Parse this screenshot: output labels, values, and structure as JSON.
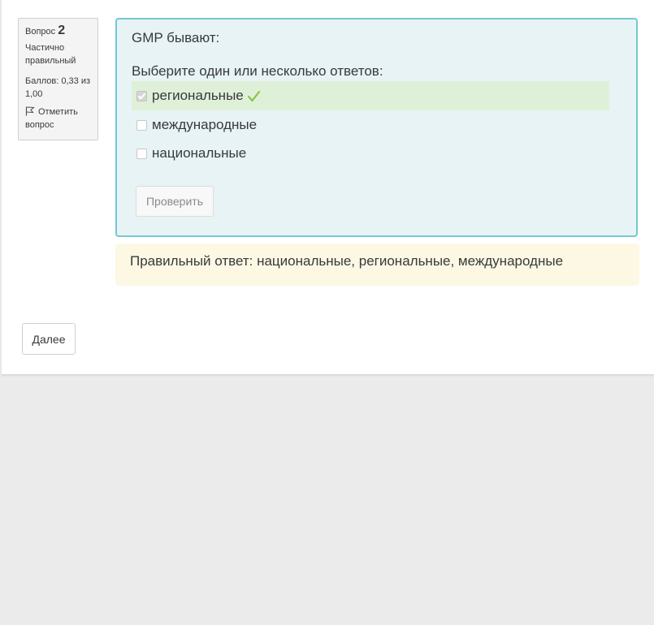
{
  "question_info": {
    "label": "Вопрос",
    "number": "2",
    "state": "Частично правильный",
    "grade": "Баллов: 0,33 из 1,00",
    "flag_label": "Отметить вопрос"
  },
  "question": {
    "text": "GMP бывают:",
    "prompt": "Выберите один или несколько ответов:",
    "options": [
      {
        "label": "региональные",
        "checked": true,
        "correct": true
      },
      {
        "label": "международные",
        "checked": false
      },
      {
        "label": "национальные",
        "checked": false
      }
    ],
    "check_button": "Проверить"
  },
  "feedback": {
    "right_answer": "Правильный ответ: национальные, региональные, международные"
  },
  "navigation": {
    "next_button": "Далее"
  },
  "colors": {
    "formulation_bg": "#e7f3f5",
    "formulation_border": "#74c8d4",
    "correct_bg": "#dff0d8",
    "feedback_bg": "#fcf8e3",
    "tick": "#8bc34a"
  },
  "icons": {
    "flag": "flag-icon",
    "correct": "check-icon"
  }
}
